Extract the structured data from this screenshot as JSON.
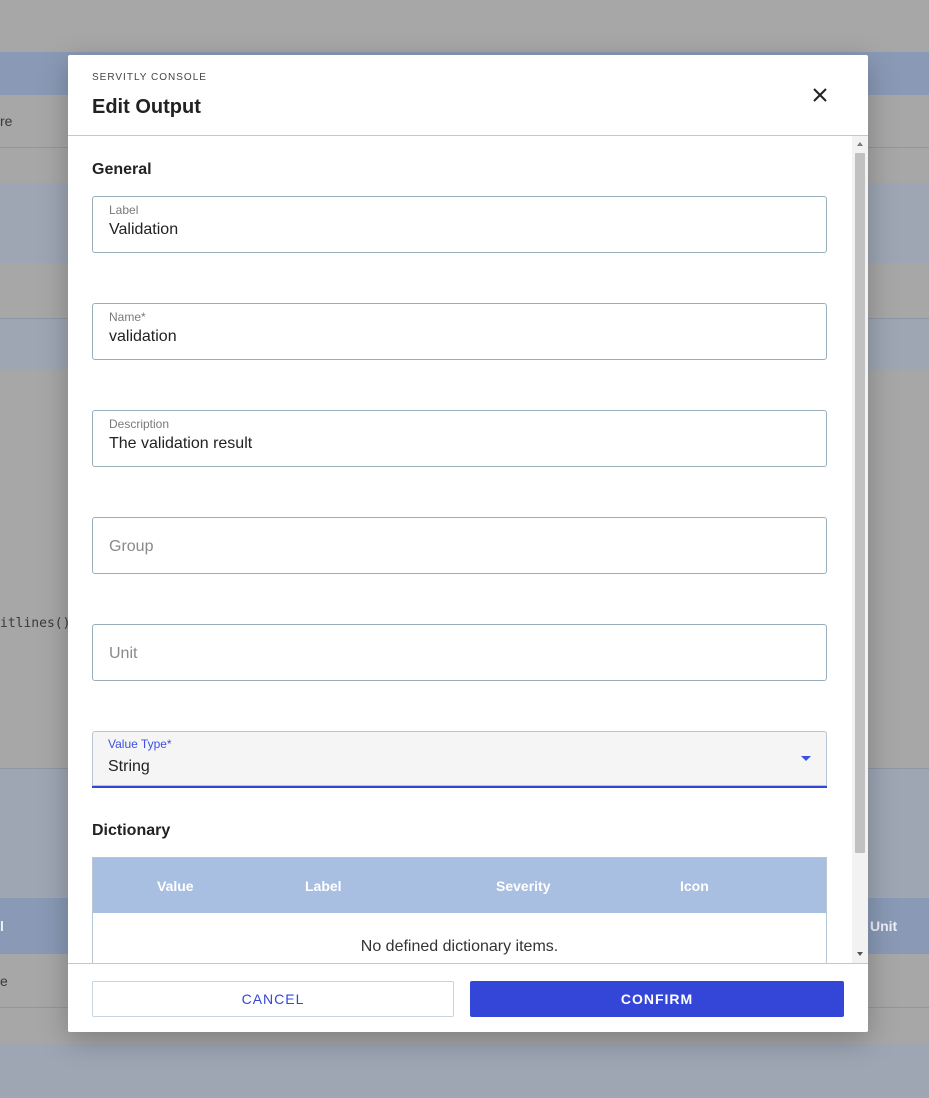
{
  "background": {
    "fragment_top": "re",
    "fragment_code": "itlines()",
    "fragment_bottom_left": "l",
    "fragment_bottom_left2": "e",
    "fragment_unit": "Unit"
  },
  "modal": {
    "overline": "SERVITLY CONSOLE",
    "title": "Edit Output",
    "close_icon": "close-icon",
    "section_general": "General",
    "fields": {
      "label": {
        "label": "Label",
        "value": "Validation"
      },
      "name": {
        "label": "Name*",
        "value": "validation"
      },
      "description": {
        "label": "Description",
        "value": "The validation result"
      },
      "group": {
        "placeholder": "Group"
      },
      "unit": {
        "placeholder": "Unit"
      },
      "value_type": {
        "label": "Value Type*",
        "value": "String"
      }
    },
    "section_dictionary": "Dictionary",
    "dictionary_table": {
      "columns": [
        "Value",
        "Label",
        "Severity",
        "Icon"
      ],
      "empty_text": "No defined dictionary items."
    },
    "footer": {
      "cancel_label": "CANCEL",
      "confirm_label": "CONFIRM"
    }
  },
  "colors": {
    "accent": "#3446d8",
    "table_header": "#a9bfe1",
    "overlay": "#a7a7a7"
  }
}
